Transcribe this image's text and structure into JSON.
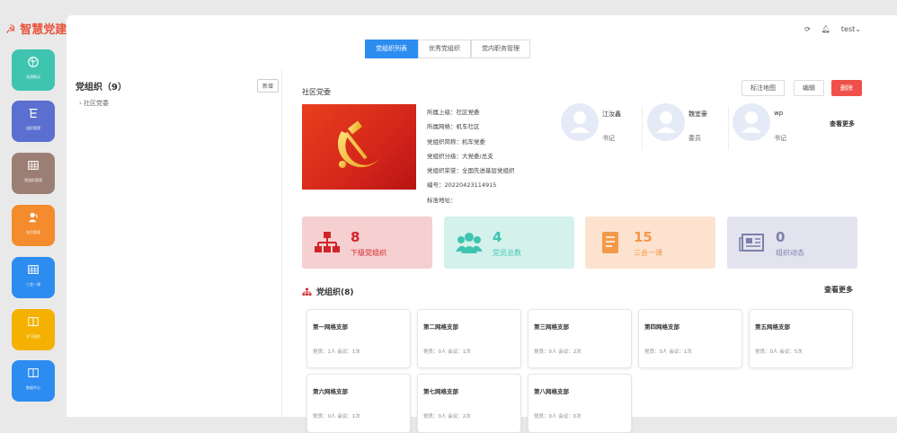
{
  "brand": {
    "logo_text": "智慧党建",
    "accent": "#e8523c"
  },
  "sidebar": {
    "items": [
      {
        "label": "党建概况",
        "color": "#3fc4b0",
        "icon": "globe-icon"
      },
      {
        "label": "组织管理",
        "color": "#5b6fd0",
        "icon": "tree-icon"
      },
      {
        "label": "党组织管理",
        "color": "#9c7f74",
        "icon": "table-icon"
      },
      {
        "label": "党员管理",
        "color": "#f48b2c",
        "icon": "user-icon"
      },
      {
        "label": "三会一课",
        "color": "#2d8cf0",
        "icon": "grid-icon"
      },
      {
        "label": "学习园地",
        "color": "#f5b100",
        "icon": "book-icon"
      },
      {
        "label": "数据中心",
        "color": "#2d8cf0",
        "icon": "book-icon"
      }
    ]
  },
  "header": {
    "tabs": [
      "党组织列表",
      "优秀党组织",
      "党内职务管理"
    ],
    "active_tab": 0,
    "user_name": "test"
  },
  "left_panel": {
    "title": "党组织（9）",
    "add_label": "新增",
    "tree": [
      "社区党委"
    ]
  },
  "detail": {
    "org_name": "社区党委",
    "actions": {
      "map": "标注地图",
      "edit": "编辑",
      "delete": "删除"
    },
    "info": [
      "所属上级：社区党委",
      "所属网格：机车社区",
      "党组织简称：机车党委",
      "党组织分级：大党委/总支",
      "党组织荣誉：全国先进基层党组织",
      "编号：20220423114915",
      "标准地址："
    ],
    "members": [
      {
        "name": "江汝鑫",
        "role": "书记"
      },
      {
        "name": "魏宜豪",
        "role": "委员"
      },
      {
        "name": "wp",
        "role": "书记"
      }
    ],
    "members_more": "查看更多"
  },
  "stats": [
    {
      "value": "8",
      "label": "下级党组织",
      "bg": "#f6cfd0",
      "fg": "#d0242a",
      "icon": "org-chart-icon"
    },
    {
      "value": "4",
      "label": "党员总数",
      "bg": "#d5f1ec",
      "fg": "#3fc4b0",
      "icon": "people-icon"
    },
    {
      "value": "15",
      "label": "三会一课",
      "bg": "#fde3cf",
      "fg": "#f29a4a",
      "icon": "notebook-icon"
    },
    {
      "value": "0",
      "label": "组织动态",
      "bg": "#e3e3f0",
      "fg": "#7a80a8",
      "icon": "newspaper-icon"
    }
  ],
  "suborgs": {
    "title": "党组织(8)",
    "more": "查看更多",
    "cards": [
      {
        "name": "第一网格支部",
        "stat": "党员：1人 会议：1次"
      },
      {
        "name": "第二网格支部",
        "stat": "党员：0人 会议：1次"
      },
      {
        "name": "第三网格支部",
        "stat": "党员：0人 会议：2次"
      },
      {
        "name": "第四网格支部",
        "stat": "党员：0人 会议：1次"
      },
      {
        "name": "第五网格支部",
        "stat": "党员：0人 会议：5次"
      },
      {
        "name": "第六网格支部",
        "stat": "党员：0人 会议：1次"
      },
      {
        "name": "第七网格支部",
        "stat": "党员：0人 会议：2次"
      },
      {
        "name": "第八网格支部",
        "stat": "党员：0人 会议：0次"
      }
    ]
  }
}
